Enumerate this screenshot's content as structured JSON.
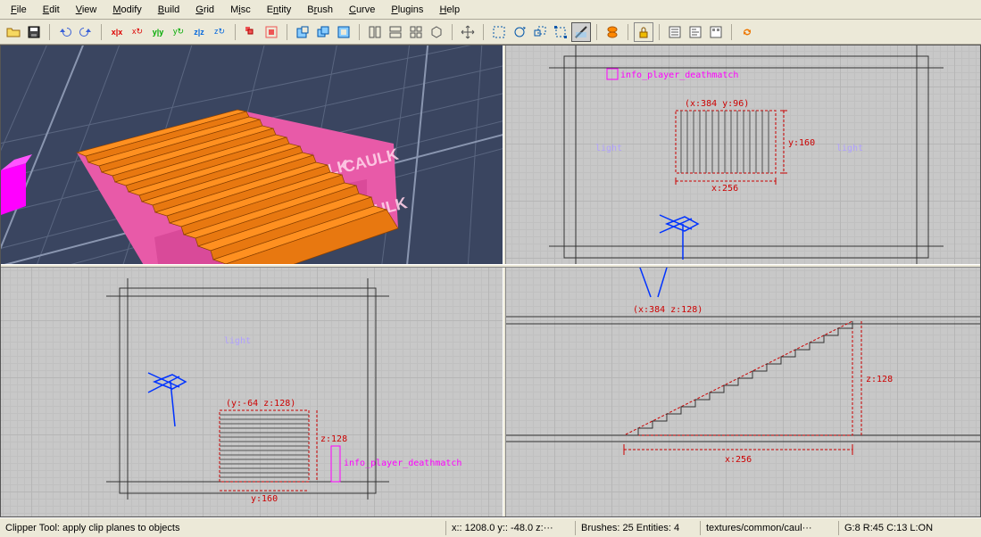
{
  "menu": {
    "file": "File",
    "edit": "Edit",
    "view": "View",
    "modify": "Modify",
    "build": "Build",
    "grid": "Grid",
    "misc": "Misc",
    "entity": "Entity",
    "brush": "Brush",
    "curve": "Curve",
    "plugins": "Plugins",
    "help": "Help"
  },
  "status": {
    "hint": "Clipper Tool: apply clip planes to objects",
    "coords": "x:: 1208.0  y:: -48.0  z:···",
    "counts": "Brushes: 25 Entities: 4",
    "texture": "textures/common/caul···",
    "grid": "G:8  R:45  C:13  L:ON"
  },
  "xy": {
    "entity": "info_player_deathmatch",
    "coords": "(x:384  y:96)",
    "dimx": "x:256",
    "dimy": "y:160",
    "light1": "light",
    "light2": "light"
  },
  "yz": {
    "entity": "info_player_deathmatch",
    "coords": "(y:-64  z:128)",
    "dimy": "y:160",
    "dimz": "z:128",
    "light": "light"
  },
  "xz": {
    "coords": "(x:384  z:128)",
    "dimx": "x:256",
    "dimz": "z:128"
  },
  "tex": {
    "caulk": "CAULK"
  }
}
